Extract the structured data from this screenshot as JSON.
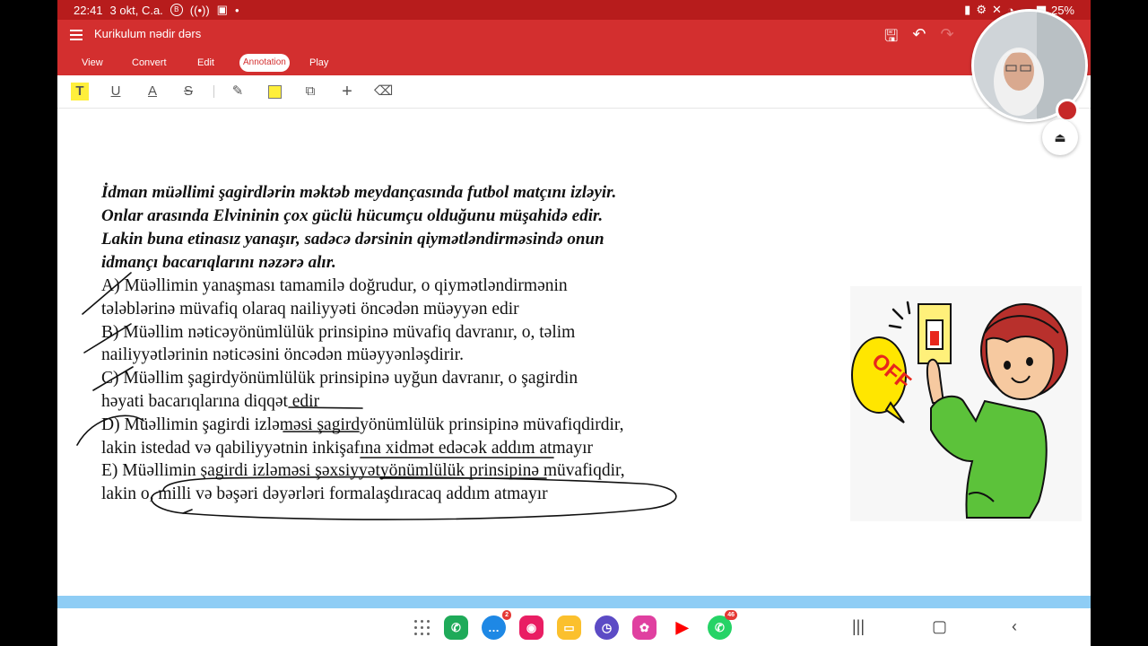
{
  "status": {
    "time": "22:41",
    "date": "3 okt, C.a.",
    "battery": "25%"
  },
  "app": {
    "doc_title": "Kurikulum  nədir dərs",
    "tabs": [
      "View",
      "Convert",
      "Edit",
      "Annotation",
      "Play"
    ],
    "active_tab": "Annotation"
  },
  "toolbar": {
    "tools": [
      "highlighter-text",
      "underline",
      "text-color",
      "strikethrough",
      "pen",
      "area-highlight",
      "shapes",
      "add",
      "eraser"
    ]
  },
  "question": {
    "stem": [
      " İdman müəllimi şagirdlərin məktəb meydançasında futbol matçını izləyir.",
      "Onlar arasında Elvininin çox güclü hücumçu olduğunu müşahidə edir.",
      "Lakin buna etinasız yanaşır, sadəcə dərsinin qiymətləndirməsində onun",
      "idmançı bacarıqlarını nəzərə alır."
    ],
    "options": [
      "A) Müəllimin yanaşması tamamilə doğrudur, o qiymətləndirmənin",
      "tələblərinə müvafiq olaraq nailiyyəti öncədən müəyyən edir",
      "B) Müəllim nəticəyönümlülük prinsipinə müvafiq davranır, o, təlim",
      "nailiyyətlərinin nəticəsini öncədən müəyyənləşdirir.",
      "C)   Müəllim şagirdyönümlülük prinsipinə uyğun davranır, o şagirdin",
      "həyati bacarıqlarına diqqət edir",
      "D) Müəllimin şagirdi izləməsi şagirdyönümlülük prinsipinə müvafiqdirdir,",
      "lakin istedad və qabiliyyətnin inkişafına xidmət edəcək addım atmayır",
      "E) Müəllimin şagirdi izləməsi şəxsiyyətyönümlülük prinsipinə müvafiqdir,",
      "lakin o, milli və bəşəri dəyərləri formalaşdıracaq addım atmayır"
    ]
  },
  "cartoon": {
    "sign_text": "OFF"
  },
  "navbar": {
    "apps": [
      {
        "name": "phone",
        "color": "#1faa59"
      },
      {
        "name": "messages",
        "color": "#1e88e5",
        "badge": "2"
      },
      {
        "name": "camera",
        "color": "#e91e63"
      },
      {
        "name": "files",
        "color": "#fbc02d"
      },
      {
        "name": "clock",
        "color": "#5c4bc5"
      },
      {
        "name": "gallery",
        "color": "#e040a0"
      },
      {
        "name": "youtube",
        "color": "#ff0000"
      },
      {
        "name": "whatsapp",
        "color": "#25d366",
        "badge": "46"
      }
    ]
  },
  "colors": {
    "appbar": "#d32f2f",
    "statusbar": "#b71c1c",
    "progress": "#8ecdf5"
  }
}
